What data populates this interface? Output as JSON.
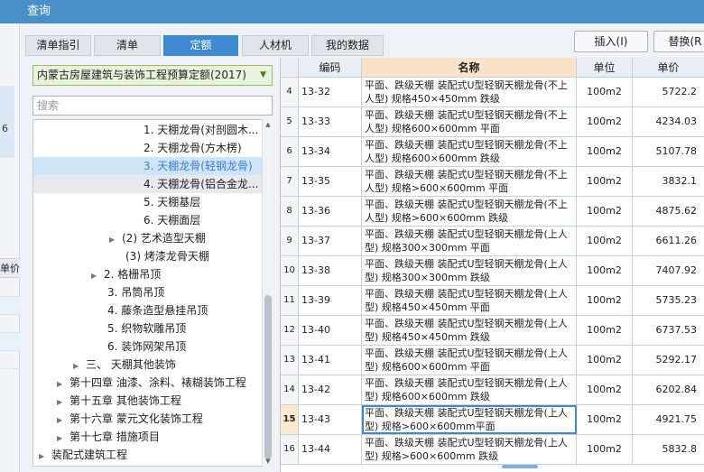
{
  "window": {
    "title": "查询"
  },
  "background": {
    "fragment_number": "6",
    "column_label": "单价"
  },
  "tabs": [
    "清单指引",
    "清单",
    "定额",
    "人材机",
    "我的数据"
  ],
  "buttons": {
    "insert": "插入(I)",
    "replace": "替换(R"
  },
  "database": {
    "selected": "内蒙古房屋建筑与装饰工程预算定额(2017)"
  },
  "search": {
    "placeholder": "搜索"
  },
  "tree": [
    "1. 天棚龙骨(对剖圆木...",
    "2. 天棚龙骨(方木楞)",
    "3. 天棚龙骨(轻钢龙骨)",
    "4. 天棚龙骨(铝合金龙...",
    "5. 天棚基层",
    "6. 天棚面层",
    "(2) 艺术造型天棚",
    "(3) 烤漆龙骨天棚",
    "2. 格栅吊顶",
    "3. 吊筒吊顶",
    "4. 藤条造型悬挂吊顶",
    "5. 织物软雕吊顶",
    "6. 装饰网架吊顶",
    "三、 天棚其他装饰",
    "第十四章 油漆、涂料、裱糊装饰工程",
    "第十五章 其他装饰工程",
    "第十六章 蒙元文化装饰工程",
    "第十七章 措施项目",
    "装配式建筑工程"
  ],
  "table": {
    "headers": {
      "idx": "",
      "code": "编码",
      "name": "名称",
      "unit": "单位",
      "price": "单价"
    },
    "rows": [
      {
        "idx": "4",
        "code": "13-32",
        "name": "平面、跌级天棚 装配式U型轻钢天棚龙骨(不上人型) 规格450×450mm 跌级",
        "unit": "100m2",
        "price": "5722.2"
      },
      {
        "idx": "5",
        "code": "13-33",
        "name": "平面、跌级天棚 装配式U型轻钢天棚龙骨(不上人型) 规格600×600mm 平面",
        "unit": "100m2",
        "price": "4234.03"
      },
      {
        "idx": "6",
        "code": "13-34",
        "name": "平面、跌级天棚 装配式U型轻钢天棚龙骨(不上人型) 规格600×600mm 跌级",
        "unit": "100m2",
        "price": "5107.78"
      },
      {
        "idx": "7",
        "code": "13-35",
        "name": "平面、跌级天棚 装配式U型轻钢天棚龙骨(不上人型) 规格>600×600mm 平面",
        "unit": "100m2",
        "price": "3832.1"
      },
      {
        "idx": "8",
        "code": "13-36",
        "name": "平面、跌级天棚 装配式U型轻钢天棚龙骨(不上人型) 规格>600×600mm 跌级",
        "unit": "100m2",
        "price": "4875.62"
      },
      {
        "idx": "9",
        "code": "13-37",
        "name": "平面、跌级天棚 装配式U型轻钢天棚龙骨(上人型) 规格300×300mm 平面",
        "unit": "100m2",
        "price": "6611.26"
      },
      {
        "idx": "10",
        "code": "13-38",
        "name": "平面、跌级天棚 装配式U型轻钢天棚龙骨(上人型) 规格300×300mm 跌级",
        "unit": "100m2",
        "price": "7407.92"
      },
      {
        "idx": "11",
        "code": "13-39",
        "name": "平面、跌级天棚 装配式U型轻钢天棚龙骨(上人型) 规格450×450mm 平面",
        "unit": "100m2",
        "price": "5735.23"
      },
      {
        "idx": "12",
        "code": "13-40",
        "name": "平面、跌级天棚 装配式U型轻钢天棚龙骨(上人型) 规格450×450mm 跌级",
        "unit": "100m2",
        "price": "6737.53"
      },
      {
        "idx": "13",
        "code": "13-41",
        "name": "平面、跌级天棚 装配式U型轻钢天棚龙骨(上人型) 规格600×600mm 平面",
        "unit": "100m2",
        "price": "5292.17"
      },
      {
        "idx": "14",
        "code": "13-42",
        "name": "平面、跌级天棚 装配式U型轻钢天棚龙骨(上人型) 规格600×600mm 跌级",
        "unit": "100m2",
        "price": "6202.84"
      },
      {
        "idx": "15",
        "code": "13-43",
        "name": "平面、跌级天棚 装配式U型轻钢天棚龙骨(上人型) 规格>600×600mm平面",
        "unit": "100m2",
        "price": "4921.75"
      },
      {
        "idx": "16",
        "code": "13-44",
        "name": "平面、跌级天棚 装配式U型轻钢天棚龙骨(上人型) 规格>600×600mm 跌级",
        "unit": "100m2",
        "price": "5832.8"
      }
    ]
  }
}
